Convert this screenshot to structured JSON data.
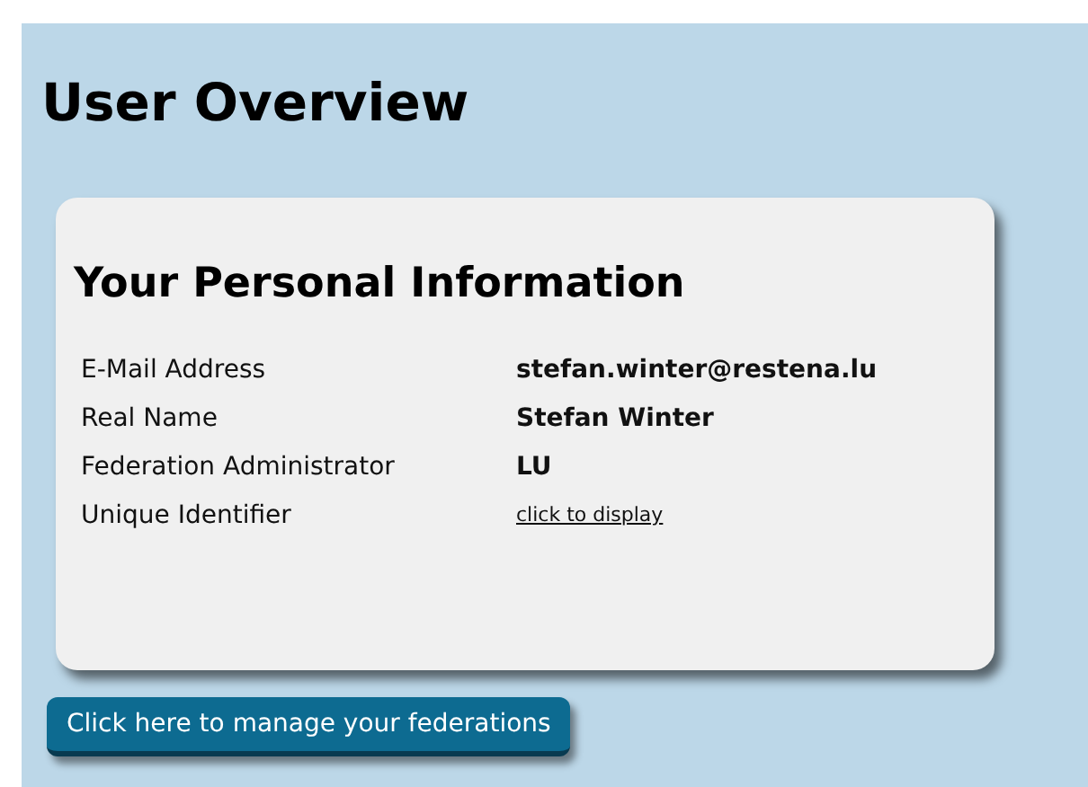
{
  "page_title": "User Overview",
  "card": {
    "title": "Your Personal Information",
    "rows": [
      {
        "label": "E-Mail Address",
        "value": "stefan.winter@restena.lu",
        "kind": "text"
      },
      {
        "label": "Real Name",
        "value": "Stefan Winter",
        "kind": "text"
      },
      {
        "label": "Federation Administrator",
        "value": "LU",
        "kind": "text"
      },
      {
        "label": "Unique Identifier",
        "value": "click to display",
        "kind": "link"
      }
    ]
  },
  "button": "Click here to manage your federations"
}
